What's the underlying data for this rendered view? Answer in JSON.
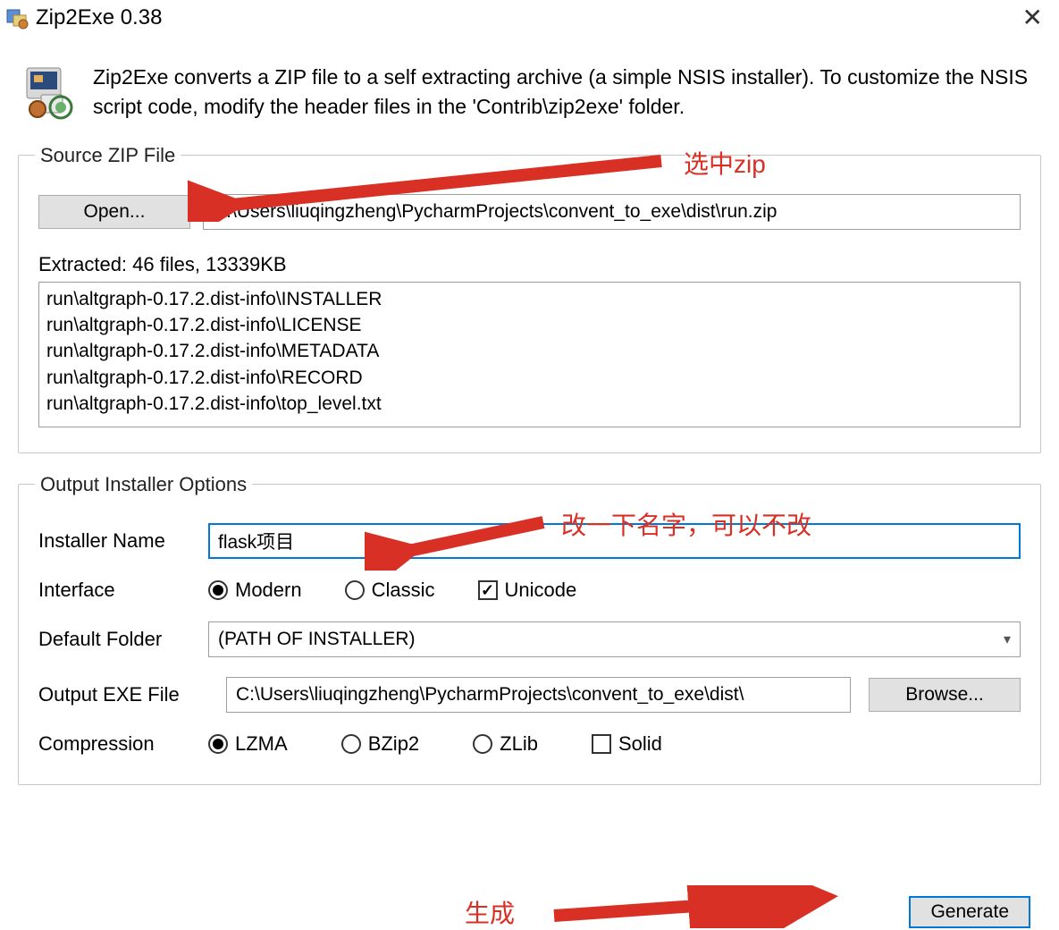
{
  "window": {
    "title": "Zip2Exe 0.38"
  },
  "intro": {
    "text": "Zip2Exe converts a ZIP file to a self extracting archive (a simple NSIS installer). To customize the NSIS script code, modify the header files in the 'Contrib\\zip2exe' folder."
  },
  "source": {
    "legend": "Source ZIP File",
    "open_label": "Open...",
    "path": "C:\\Users\\liuqingzheng\\PycharmProjects\\convent_to_exe\\dist\\run.zip",
    "extracted_label": "Extracted: 46 files, 13339KB",
    "files": [
      "run\\altgraph-0.17.2.dist-info\\INSTALLER",
      "run\\altgraph-0.17.2.dist-info\\LICENSE",
      "run\\altgraph-0.17.2.dist-info\\METADATA",
      "run\\altgraph-0.17.2.dist-info\\RECORD",
      "run\\altgraph-0.17.2.dist-info\\top_level.txt"
    ]
  },
  "output": {
    "legend": "Output Installer Options",
    "name_label": "Installer Name",
    "name_value": "flask项目",
    "interface_label": "Interface",
    "interface_modern": "Modern",
    "interface_classic": "Classic",
    "interface_unicode": "Unicode",
    "folder_label": "Default Folder",
    "folder_value": "(PATH OF INSTALLER)",
    "exe_label": "Output EXE File",
    "exe_value": "C:\\Users\\liuqingzheng\\PycharmProjects\\convent_to_exe\\dist\\",
    "browse_label": "Browse...",
    "compression_label": "Compression",
    "comp_lzma": "LZMA",
    "comp_bzip2": "BZip2",
    "comp_zlib": "ZLib",
    "comp_solid": "Solid"
  },
  "generate_label": "Generate",
  "annotations": {
    "select_zip": "选中zip",
    "rename": "改一下名字，可以不改",
    "generate": "生成"
  }
}
